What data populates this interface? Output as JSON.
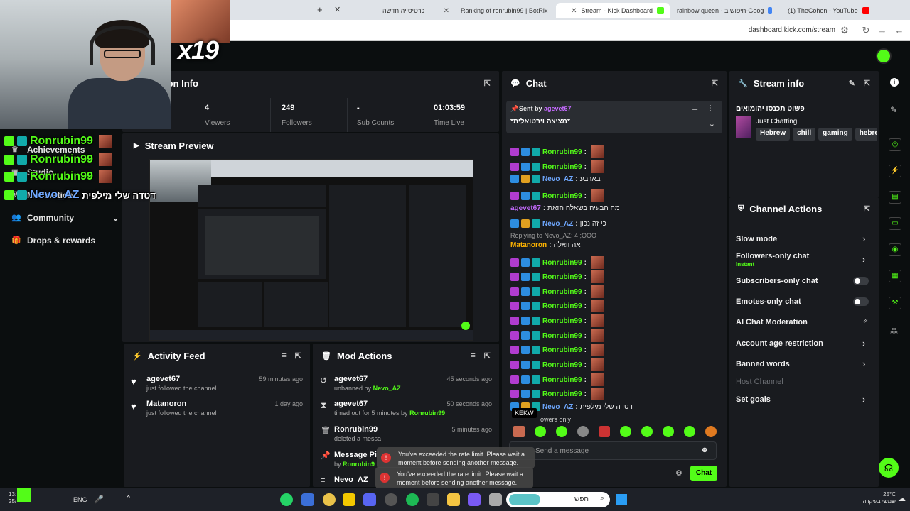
{
  "browser": {
    "tabs": [
      {
        "title": "כרטיסייה חדשה",
        "active": false
      },
      {
        "title": "Ranking of ronrubin99 | BotRix",
        "active": false
      },
      {
        "title": "Stream - Kick Dashboard",
        "active": true
      },
      {
        "title": "rainbow queen - חיפוש ב-Goog",
        "active": false
      },
      {
        "title": "(1) TheCohen - YouTube",
        "active": false
      }
    ],
    "url": "dashboard.kick.com/stream"
  },
  "overlay": {
    "multiplier": "x19",
    "chat_lines": [
      {
        "user": "Ronrubin99",
        "text": ""
      },
      {
        "user": "Ronrubin99",
        "text": ""
      },
      {
        "user": "Ronrubin99",
        "text": ""
      },
      {
        "user": "Nevo_AZ",
        "text": "דטדה שלי מילפית"
      }
    ]
  },
  "sidebar": {
    "items": [
      {
        "label": "Achievements"
      },
      {
        "label": "Studio"
      },
      {
        "label": "Moderation"
      },
      {
        "label": "Community"
      },
      {
        "label": "Drops & rewards"
      }
    ]
  },
  "session": {
    "title_partial": "ion Info",
    "stats": [
      {
        "value": "4",
        "label": "Viewers"
      },
      {
        "value": "249",
        "label": "Followers"
      },
      {
        "value": "-",
        "label": "Sub Counts"
      },
      {
        "value": "01:03:59",
        "label": "Time Live"
      }
    ]
  },
  "preview": {
    "title": "Stream Preview"
  },
  "activity_feed": {
    "title": "Activity Feed",
    "items": [
      {
        "name": "agevet67",
        "sub": "just followed the channel",
        "time": "59 minutes ago"
      },
      {
        "name": "Matanoron",
        "sub": "just followed the channel",
        "time": "1 day ago"
      }
    ]
  },
  "mod_actions": {
    "title": "Mod Actions",
    "items": [
      {
        "name": "agevet67",
        "action": "unbanned by",
        "by": "Nevo_AZ",
        "time": "45 seconds ago"
      },
      {
        "name": "agevet67",
        "action": "timed out for 5 minutes by",
        "by": "Ronrubin99",
        "time": "50 seconds ago"
      },
      {
        "name": "Ronrubin99",
        "action": "deleted a messa",
        "by": "",
        "time": "5 minutes ago"
      },
      {
        "name": "Message Pi",
        "action": "by",
        "by": "Ronrubin9",
        "time": ""
      },
      {
        "name": "Nevo_AZ",
        "action": "",
        "by": "",
        "time": ""
      }
    ]
  },
  "chat": {
    "title": "Chat",
    "pinned": {
      "sent_by_label": "Sent by",
      "sent_by": "agevet67",
      "text": "*מציצה וירטואלית*"
    },
    "messages": [
      {
        "user": "Ronrubin99",
        "text": ""
      },
      {
        "user": "Ronrubin99",
        "text": ""
      },
      {
        "user": "Nevo_AZ",
        "text": "בארבע"
      },
      {
        "user": "Ronrubin99",
        "text": ""
      },
      {
        "user": "agevet67",
        "text": "מה הבעיה בשאלה הזאת"
      },
      {
        "user": "Nevo_AZ",
        "text": "כי זה נכון"
      },
      {
        "reply": "Replying to Nevo_AZ: 4 ;OOO"
      },
      {
        "user": "Matanoron",
        "text": "אה וואלה"
      },
      {
        "user": "Ronrubin99",
        "text": ""
      },
      {
        "user": "Ronrubin99",
        "text": ""
      },
      {
        "user": "Ronrubin99",
        "text": ""
      },
      {
        "user": "Ronrubin99",
        "text": ""
      },
      {
        "user": "Ronrubin99",
        "text": ""
      },
      {
        "user": "Ronrubin99",
        "text": ""
      },
      {
        "user": "Ronrubin99",
        "text": ""
      },
      {
        "user": "Ronrubin99",
        "text": ""
      },
      {
        "user": "Ronrubin99",
        "text": ""
      },
      {
        "user": "Ronrubin99",
        "text": ""
      },
      {
        "user": "Nevo_AZ",
        "text": "דטדה שלי מילפית"
      }
    ],
    "tooltip": "KEKW",
    "followers_only": "owers only",
    "input_placeholder": "Send a message",
    "send_label": "Chat"
  },
  "stream_info": {
    "title": "Stream info",
    "stream_title": "פשוט תכנסו יהומואים",
    "category": "Just Chatting",
    "tags": [
      "Hebrew",
      "chill",
      "gaming",
      "hebre"
    ]
  },
  "channel_actions": {
    "title": "Channel Actions",
    "items": [
      {
        "label": "Slow mode",
        "sub": "",
        "control": "chevron"
      },
      {
        "label": "Followers-only chat",
        "sub": "Instant",
        "control": "chevron"
      },
      {
        "label": "Subscribers-only chat",
        "sub": "",
        "control": "toggle"
      },
      {
        "label": "Emotes-only chat",
        "sub": "",
        "control": "toggle"
      },
      {
        "label": "AI Chat Moderation",
        "sub": "",
        "control": "external"
      },
      {
        "label": "Account age restriction",
        "sub": "",
        "control": "chevron"
      },
      {
        "label": "Banned words",
        "sub": "",
        "control": "chevron"
      },
      {
        "label": "Host Channel",
        "sub": "",
        "control": "none"
      },
      {
        "label": "Set goals",
        "sub": "",
        "control": "chevron"
      }
    ]
  },
  "toasts": [
    {
      "text": "You've exceeded the rate limit. Please wait a moment before sending another message."
    },
    {
      "text": "You've exceeded the rate limit. Please wait a moment before sending another message."
    }
  ],
  "taskbar": {
    "time": "13:",
    "date": "25/",
    "lang": "ENG",
    "search_placeholder": "חפש",
    "weather_temp": "25°C",
    "weather_text": "שמשי בעיקרה"
  },
  "colors": {
    "accent": "#53fc18",
    "panel": "#191b1f",
    "bg": "#0b0e0f"
  }
}
